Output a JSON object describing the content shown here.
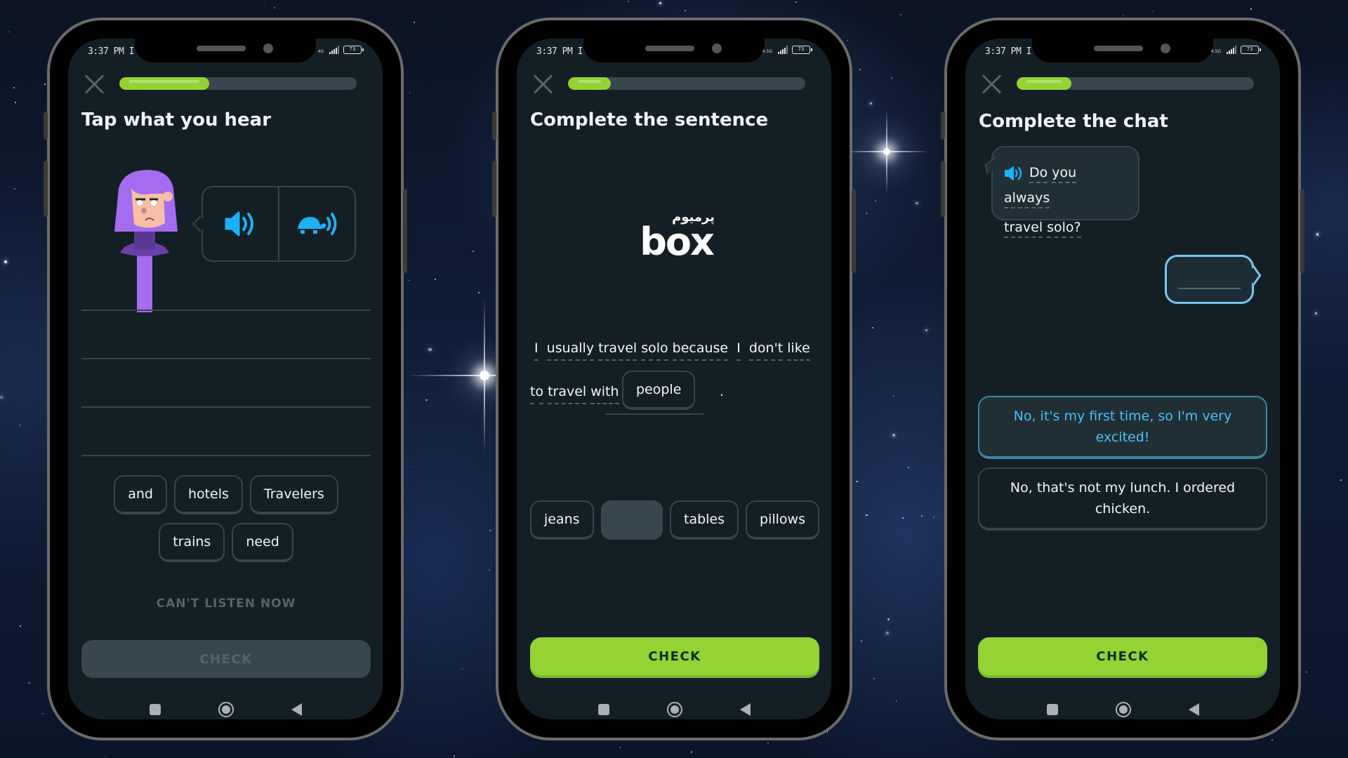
{
  "colors": {
    "accent_green": "#93d333",
    "accent_blue": "#1cb0f6",
    "screen_bg": "#131f24",
    "border": "#37464f",
    "character_purple": "#a56bf0"
  },
  "phones": [
    {
      "status": {
        "time": "3:37 PM I",
        "network": "4G",
        "battery": "73"
      },
      "progress": 0.38,
      "title": "Tap what you hear",
      "audio_buttons": [
        {
          "icon": "speaker-icon",
          "label": "Play audio"
        },
        {
          "icon": "turtle-speaker-icon",
          "label": "Play slow audio"
        }
      ],
      "word_bank_rows": [
        [
          "and",
          "hotels",
          "Travelers"
        ],
        [
          "trains",
          "need"
        ]
      ],
      "cant_listen": "CAN'T LISTEN NOW",
      "check": "CHECK",
      "check_state": "disabled"
    },
    {
      "status": {
        "time": "3:37 PM I",
        "network": "4.5G",
        "battery": "73"
      },
      "progress": 0.18,
      "title": "Complete the sentence",
      "watermark": {
        "persian": "پرمیوم",
        "latin": "box"
      },
      "sentence_line1": [
        "I",
        "usually",
        "travel",
        "solo",
        "because",
        "I",
        "don't",
        "like"
      ],
      "sentence_line2": [
        "to",
        "travel",
        "with"
      ],
      "filled_word": "people",
      "sentence_end": ".",
      "word_bank": [
        "jeans",
        "",
        "tables",
        "pillows"
      ],
      "check": "CHECK",
      "check_state": "active"
    },
    {
      "status": {
        "time": "3:37 PM I",
        "network": "4.5G",
        "battery": "73"
      },
      "progress": 0.23,
      "title": "Complete the chat",
      "question_line1": [
        "Do",
        "you",
        "always"
      ],
      "question_line2": [
        "travel",
        "solo?"
      ],
      "options": [
        {
          "text": "No, it's my first time, so I'm very excited!",
          "selected": true
        },
        {
          "text": "No, that's not my lunch. I ordered chicken.",
          "selected": false
        }
      ],
      "check": "CHECK",
      "check_state": "active"
    }
  ],
  "nav": {
    "recent": "recent-apps",
    "home": "home",
    "back": "back"
  }
}
